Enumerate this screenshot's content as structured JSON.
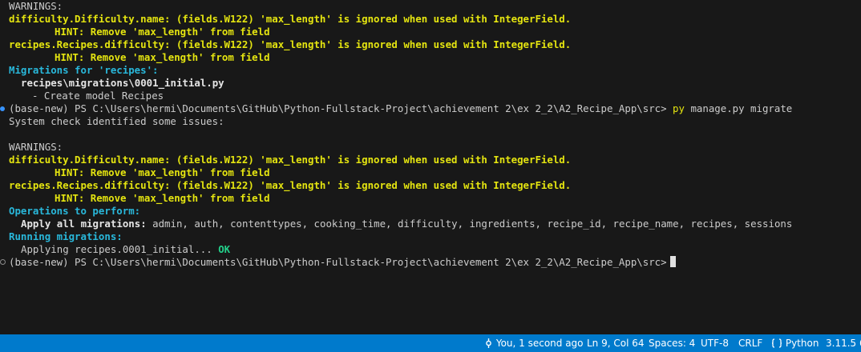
{
  "terminal": {
    "warnings_header": "WARNINGS:",
    "warn1": "difficulty.Difficulty.name: (fields.W122) 'max_length' is ignored when used with IntegerField.",
    "hint": "HINT: Remove 'max_length' from field",
    "warn2": "recipes.Recipes.difficulty: (fields.W122) 'max_length' is ignored when used with IntegerField.",
    "migrations_for": "Migrations for 'recipes':",
    "migration_file": "recipes\\migrations\\0001_initial.py",
    "create_model": "- Create model Recipes",
    "prompt": "(base-new) PS C:\\Users\\hermi\\Documents\\GitHub\\Python-Fullstack-Project\\achievement 2\\ex 2_2\\A2_Recipe_App\\src>",
    "cmd_py": "py",
    "cmd_args": "manage.py migrate",
    "system_check": "System check identified some issues:",
    "ops_header": "Operations to perform:",
    "apply_all_label": "Apply all migrations:",
    "apply_all_value": "admin, auth, contenttypes, cooking_time, difficulty, ingredients, recipe_id, recipe_name, recipes, sessions",
    "running": "Running migrations:",
    "applying": "Applying recipes.0001_initial...",
    "ok": "OK"
  },
  "status_bar": {
    "git_blame": "You, 1 second ago",
    "position": "Ln 9, Col 64",
    "spaces": "Spaces: 4",
    "encoding": "UTF-8",
    "eol": "CRLF",
    "language": "Python",
    "interpreter": "3.11.5 6"
  },
  "colors": {
    "background": "#181818",
    "warning_yellow": "#e5e510",
    "info_cyan": "#29b8db",
    "ok_green": "#23d18b",
    "status_bar": "#007acc"
  }
}
